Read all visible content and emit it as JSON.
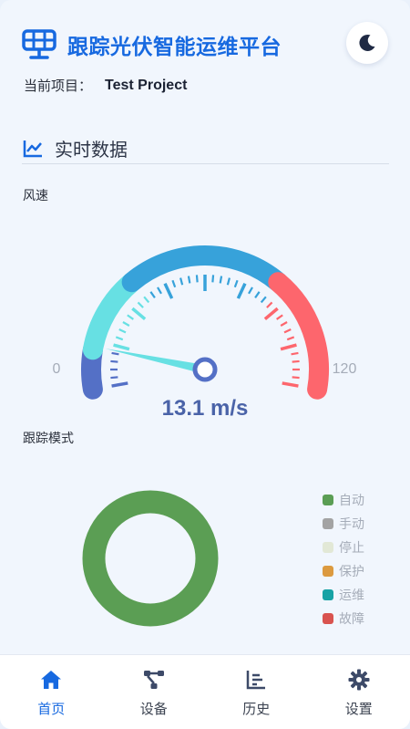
{
  "app": {
    "title": "跟踪光伏智能运维平台"
  },
  "project": {
    "label": "当前项目：",
    "value": "Test Project"
  },
  "section": {
    "title": "实时数据"
  },
  "wind": {
    "label": "风速",
    "value": 13.1,
    "display": "13.1 m/s",
    "unit": "m/s",
    "min_label": "0",
    "max_label": "120",
    "min": 0,
    "max": 120,
    "colors": {
      "low": "#5470c6",
      "mid": "#67e0e3",
      "high": "#37a2da",
      "danger": "#fd666d"
    }
  },
  "mode": {
    "label": "跟踪模式",
    "chart_data": {
      "type": "pie",
      "categories": [
        "自动",
        "手动",
        "停止",
        "保护",
        "运维",
        "故障"
      ],
      "values": [
        1,
        0,
        0,
        0,
        0,
        0
      ],
      "colors": [
        "#5b9e54",
        "#a3a3a3",
        "#e2e8d6",
        "#dc9a3f",
        "#17a2a5",
        "#d9534f"
      ]
    }
  },
  "nav": {
    "items": [
      {
        "label": "首页",
        "icon": "home-icon",
        "active": true
      },
      {
        "label": "设备",
        "icon": "device-icon",
        "active": false
      },
      {
        "label": "历史",
        "icon": "history-icon",
        "active": false
      },
      {
        "label": "设置",
        "icon": "gear-icon",
        "active": false
      }
    ]
  }
}
